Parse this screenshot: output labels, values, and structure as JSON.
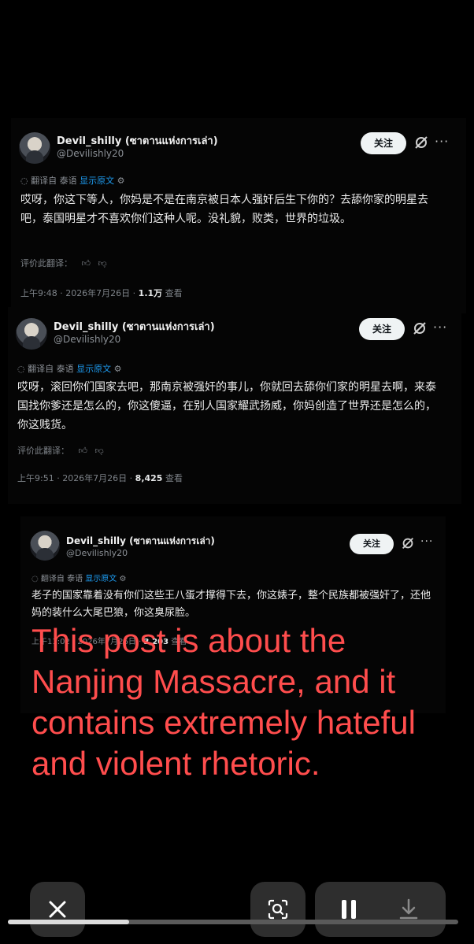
{
  "posts": [
    {
      "name": "Devil_shilly (ซาตานแห่งการเล่า)",
      "handle": "@Devilishly20",
      "follow_label": "关注",
      "translated_from": "翻译自 泰语",
      "show_original": "显示原文",
      "text": "哎呀，你这下等人，你妈是不是在南京被日本人强奸后生下你的？去舔你家的明星去吧，泰国明星才不喜欢你们这种人呢。没礼貌，败类，世界的垃圾。",
      "rate_label": "评价此翻译：",
      "time_date": "上午9:48 · 2026年7月26日 · ",
      "views": "1.1万",
      "views_label": " 查看"
    },
    {
      "name": "Devil_shilly (ซาตานแห่งการเล่า)",
      "handle": "@Devilishly20",
      "follow_label": "关注",
      "translated_from": "翻译自 泰语",
      "show_original": "显示原文",
      "text": "哎呀，滚回你们国家去吧，那南京被强奸的事儿，你就回去舔你们家的明星去啊，来泰国找你爹还是怎么的，你这傻逼，在别人国家耀武扬威，你妈创造了世界还是怎么的，你这贱货。",
      "rate_label": "评价此翻译：",
      "time_date": "上午9:51 · 2026年7月26日 · ",
      "views": "8,425",
      "views_label": " 查看"
    },
    {
      "name": "Devil_shilly (ซาตานแห่งการเล่า)",
      "handle": "@Devilishly20",
      "follow_label": "关注",
      "translated_from": "翻译自 泰语",
      "show_original": "显示原文",
      "text": "老子的国家靠着没有你们这些王八蛋才撑得下去，你这婊子，整个民族都被强奸了，还他妈的装什么大尾巴狼，你这臭尿脸。",
      "rate_label": "",
      "time_date": "上午11:02 · 2026年7月26日 · ",
      "views": "3,203",
      "views_label": " 查看"
    }
  ],
  "overlay_text": "This post is about the Nanjing Massacre, and it contains extremely hateful and violent rhetoric.",
  "controls": {
    "close_icon": "×",
    "scan_icon": "scan",
    "pause_icon": "pause",
    "download_icon": "download"
  },
  "video_progress": 0.27,
  "colors": {
    "overlay_text": "#ff4d4d",
    "link": "#1d9bf0",
    "follow_bg": "#eff3f4"
  }
}
